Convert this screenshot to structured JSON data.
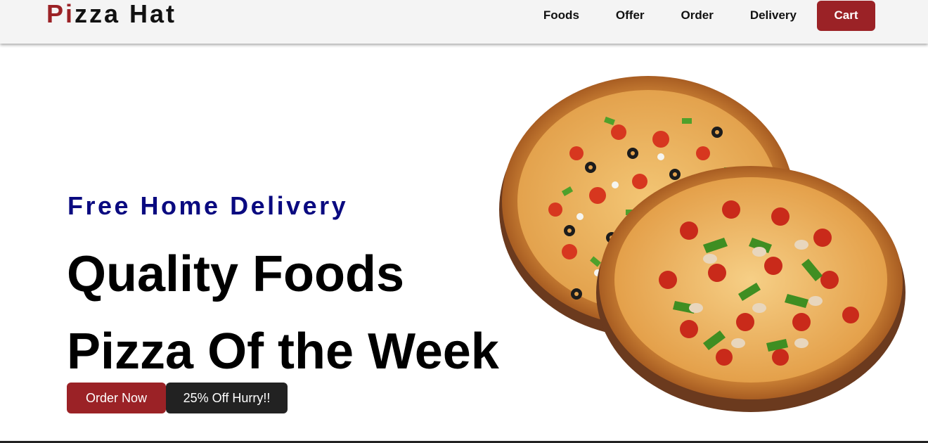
{
  "brand": {
    "first": "Pi",
    "rest": "zza Hat",
    "accent_color": "#9b2226"
  },
  "nav": {
    "links": [
      "Foods",
      "Offer",
      "Order",
      "Delivery"
    ],
    "cart_label": "Cart"
  },
  "hero": {
    "tagline": "Free Home Delivery",
    "headline_1": "Quality Foods",
    "headline_2": "Pizza Of the Week",
    "order_label": "Order Now",
    "offer_label": "25% Off Hurry!!",
    "image_icon": "pizza-image"
  },
  "colors": {
    "primary": "#9b2226",
    "tagline": "#0a0a80",
    "dark_button": "#222222",
    "navbar_bg": "#f4f4f4"
  }
}
